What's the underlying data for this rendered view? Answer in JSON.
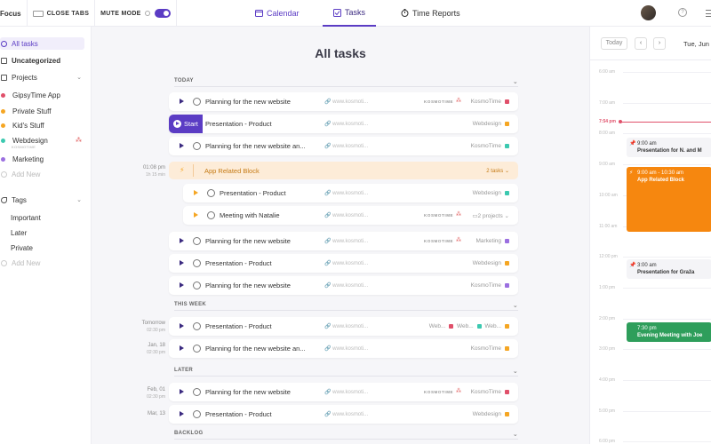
{
  "topbar": {
    "focus_label": "Focus",
    "close_tabs_label": "CLOSE TABS",
    "mute_mode_label": "MUTE MODE",
    "nav": {
      "calendar": "Calendar",
      "tasks": "Tasks",
      "time_reports": "Time Reports"
    },
    "help_glyph": "?"
  },
  "sidebar": {
    "all_tasks": "All tasks",
    "uncategorized": "Uncategorized",
    "projects_header": "Projects",
    "projects": [
      {
        "label": "GipsyTime App",
        "color": "#e0506a"
      },
      {
        "label": "Private Stuff",
        "color": "#f5a623"
      },
      {
        "label": "Kid's Stuff",
        "color": "#f5a623"
      },
      {
        "label": "Webdesign",
        "sub": "KOSMOTIME",
        "color": "#3cc9b0"
      },
      {
        "label": "Marketing",
        "color": "#9b6fe0"
      }
    ],
    "add_new": "Add New",
    "tags_header": "Tags",
    "tags": [
      "Important",
      "Later",
      "Private"
    ],
    "add_new_tag": "Add New"
  },
  "main": {
    "title": "All tasks",
    "sections": {
      "today": "TODAY",
      "this_week": "THIS WEEK",
      "later": "LATER",
      "backlog": "BACKLOG"
    },
    "start_label": "Start",
    "link_text": "www.kosmoti...",
    "kosmo": "KOSMOTIME",
    "tasks_today": [
      {
        "title": "Planning for the new website",
        "kosmo": true,
        "project": "KosmoTime",
        "color": "#e0506a"
      },
      {
        "title": "Presentation - Product",
        "kosmo": false,
        "project": "Webdesign",
        "color": "#f5a623"
      },
      {
        "title": "Planning for the new website an...",
        "kosmo": false,
        "project": "KosmoTime",
        "color": "#3cc9b0"
      }
    ],
    "block": {
      "time": "01:08 pm",
      "duration": "1h 15 min",
      "title": "App Related Block",
      "count": "2 tasks"
    },
    "block_tasks": [
      {
        "title": "Presentation - Product",
        "kosmo": false,
        "project": "Webdesign",
        "color": "#3cc9b0"
      },
      {
        "title": "Meeting with Natalie",
        "kosmo": true,
        "project": "2 projects",
        "color": ""
      }
    ],
    "tasks_today_after": [
      {
        "title": "Planning for the new website",
        "kosmo": true,
        "project": "Marketing",
        "color": "#9b6fe0"
      },
      {
        "title": "Presentation - Product",
        "kosmo": false,
        "project": "Webdesign",
        "color": "#f5a623"
      },
      {
        "title": "Planning for the new website",
        "kosmo": false,
        "project": "KosmoTime",
        "color": "#9b6fe0"
      }
    ],
    "tasks_week": [
      {
        "meta1": "Tomorrow",
        "meta2": "02:30 pm",
        "title": "Presentation - Product",
        "kosmo": false,
        "project": "Web...",
        "color": "#e0506a",
        "project2": "Web...",
        "color2": "#3cc9b0",
        "project3": "Web...",
        "color3": "#f5a623"
      },
      {
        "meta1": "Jan, 18",
        "meta2": "02:30 pm",
        "title": "Planning for the new website an...",
        "kosmo": false,
        "project": "KosmoTime",
        "color": "#f5a623"
      }
    ],
    "tasks_later": [
      {
        "meta1": "Feb, 01",
        "meta2": "02:30 pm",
        "title": "Planning for the new website",
        "kosmo": true,
        "project": "KosmoTime",
        "color": "#e0506a"
      },
      {
        "meta1": "Mar, 13",
        "meta2": "",
        "title": "Presentation - Product",
        "kosmo": false,
        "project": "Webdesign",
        "color": "#f5a623"
      }
    ]
  },
  "calendar": {
    "today_btn": "Today",
    "prev": "‹",
    "next": "›",
    "date": "Tue, Jun 2",
    "hours": [
      "6:00 am",
      "7:00 am",
      "8:00 am",
      "9:00 am",
      "10:00 am",
      "11:00 am",
      "12:00 pm",
      "1:00 pm",
      "2:00 pm",
      "3:00 pm",
      "4:00 pm",
      "5:00 pm",
      "6:00 pm"
    ],
    "now": "7:54 pm",
    "events": [
      {
        "time": "9:00 am",
        "name": "Presentation for N. and M",
        "style": "pin"
      },
      {
        "time": "9:00 am - 10:30 am",
        "name": "App Related Block",
        "style": "orange"
      },
      {
        "time": "3:00 am",
        "name": "Presentation for Graža",
        "style": "pin"
      },
      {
        "time": "7:30 pm",
        "name": "Evening Meeting with Joe",
        "style": "green"
      }
    ]
  }
}
